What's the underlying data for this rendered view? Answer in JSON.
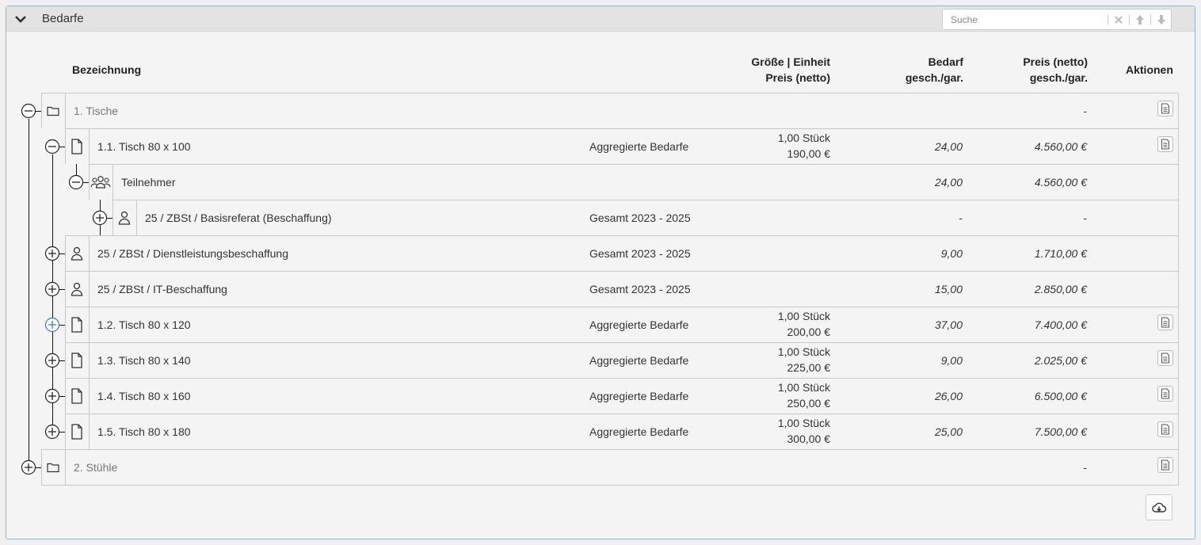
{
  "panel": {
    "title": "Bedarfe"
  },
  "search": {
    "placeholder": "Suche"
  },
  "headers": {
    "bezeichnung": "Bezeichnung",
    "groesse_line1": "Größe | Einheit",
    "groesse_line2": "Preis (netto)",
    "bedarf_line1": "Bedarf",
    "bedarf_line2": "gesch./gar.",
    "preis_line1": "Preis (netto)",
    "preis_line2": "gesch./gar.",
    "aktionen": "Aktionen"
  },
  "rows": [
    {
      "label": "1. Tische",
      "type": "",
      "unit": "",
      "unit_price": "",
      "bedarf": "",
      "preis": "-",
      "icon": "folder-icon",
      "toggle": "minus"
    },
    {
      "label": "1.1. Tisch 80 x 100",
      "type": "Aggregierte Bedarfe",
      "unit": "1,00 Stück",
      "unit_price": "190,00 €",
      "bedarf": "24,00",
      "preis": "4.560,00 €",
      "icon": "document-icon",
      "toggle": "minus"
    },
    {
      "label": "Teilnehmer",
      "type": "",
      "unit": "",
      "unit_price": "",
      "bedarf": "24,00",
      "preis": "4.560,00 €",
      "icon": "users-icon",
      "toggle": "minus"
    },
    {
      "label": "25 / ZBSt / Basisreferat (Beschaffung)",
      "type": "Gesamt 2023 - 2025",
      "unit": "",
      "unit_price": "",
      "bedarf": "-",
      "preis": "-",
      "icon": "user-icon",
      "toggle": "plus"
    },
    {
      "label": "25 / ZBSt / Dienstleistungsbeschaffung",
      "type": "Gesamt 2023 - 2025",
      "unit": "",
      "unit_price": "",
      "bedarf": "9,00",
      "preis": "1.710,00 €",
      "icon": "user-icon",
      "toggle": "plus"
    },
    {
      "label": "25 / ZBSt / IT-Beschaffung",
      "type": "Gesamt 2023 - 2025",
      "unit": "",
      "unit_price": "",
      "bedarf": "15,00",
      "preis": "2.850,00 €",
      "icon": "user-icon",
      "toggle": "plus"
    },
    {
      "label": "1.2. Tisch 80 x 120",
      "type": "Aggregierte Bedarfe",
      "unit": "1,00 Stück",
      "unit_price": "200,00 €",
      "bedarf": "37,00",
      "preis": "7.400,00 €",
      "icon": "document-icon",
      "toggle": "plus"
    },
    {
      "label": "1.3. Tisch 80 x 140",
      "type": "Aggregierte Bedarfe",
      "unit": "1,00 Stück",
      "unit_price": "225,00 €",
      "bedarf": "9,00",
      "preis": "2.025,00 €",
      "icon": "document-icon",
      "toggle": "plus"
    },
    {
      "label": "1.4. Tisch 80 x 160",
      "type": "Aggregierte Bedarfe",
      "unit": "1,00 Stück",
      "unit_price": "250,00 €",
      "bedarf": "26,00",
      "preis": "6.500,00 €",
      "icon": "document-icon",
      "toggle": "plus"
    },
    {
      "label": "1.5. Tisch 80 x 180",
      "type": "Aggregierte Bedarfe",
      "unit": "1,00 Stück",
      "unit_price": "300,00 €",
      "bedarf": "25,00",
      "preis": "7.500,00 €",
      "icon": "document-icon",
      "toggle": "plus"
    },
    {
      "label": "2. Stühle",
      "type": "",
      "unit": "",
      "unit_price": "",
      "bedarf": "",
      "preis": "-",
      "icon": "folder-icon",
      "toggle": "plus"
    }
  ]
}
